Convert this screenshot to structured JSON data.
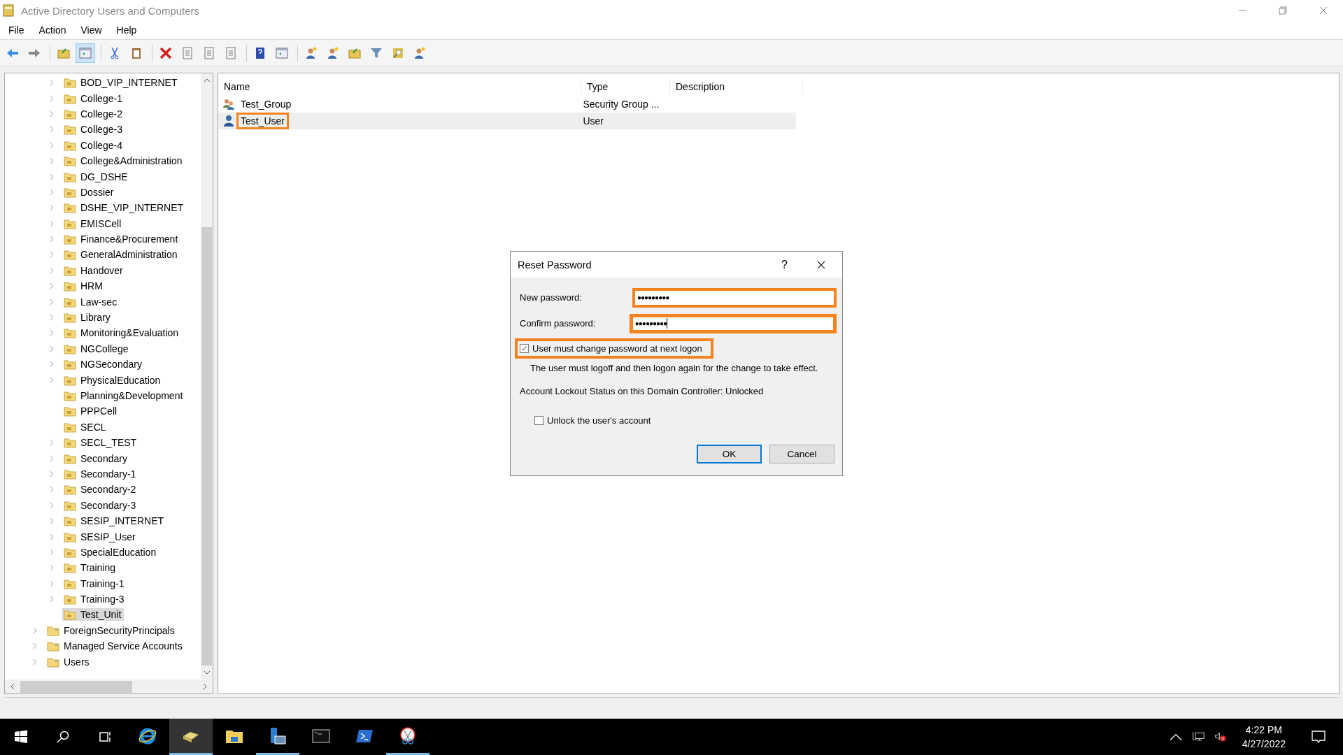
{
  "window": {
    "title": "Active Directory Users and Computers"
  },
  "menu": [
    "File",
    "Action",
    "View",
    "Help"
  ],
  "toolbar_buttons": [
    {
      "pressed": false
    },
    {
      "pressed": false
    },
    {
      "pressed": false
    },
    {
      "pressed": true
    },
    {
      "pressed": false
    },
    {
      "pressed": false
    },
    {
      "pressed": false
    },
    {
      "pressed": false
    },
    {
      "pressed": false
    },
    {
      "pressed": false
    },
    {
      "pressed": false
    },
    {
      "pressed": false
    },
    {
      "pressed": false
    },
    {
      "pressed": false
    },
    {
      "pressed": false
    },
    {
      "pressed": false
    },
    {
      "pressed": false
    },
    {
      "pressed": false
    }
  ],
  "tree": [
    {
      "children": [
        {
          "label": "BOD_VIP_INTERNET",
          "kind": "ou",
          "expandable": true,
          "selected": false
        },
        {
          "label": "College-1",
          "kind": "ou",
          "expandable": true,
          "selected": false
        },
        {
          "label": "College-2",
          "kind": "ou",
          "expandable": true,
          "selected": false
        },
        {
          "label": "College-3",
          "kind": "ou",
          "expandable": true,
          "selected": false
        },
        {
          "label": "College-4",
          "kind": "ou",
          "expandable": true,
          "selected": false
        },
        {
          "label": "College&Administration",
          "kind": "ou",
          "expandable": true,
          "selected": false
        },
        {
          "label": "DG_DSHE",
          "kind": "ou",
          "expandable": true,
          "selected": false
        },
        {
          "label": "Dossier",
          "kind": "ou",
          "expandable": true,
          "selected": false
        },
        {
          "label": "DSHE_VIP_INTERNET",
          "kind": "ou",
          "expandable": true,
          "selected": false
        },
        {
          "label": "EMISCell",
          "kind": "ou",
          "expandable": true,
          "selected": false
        },
        {
          "label": "Finance&Procurement",
          "kind": "ou",
          "expandable": true,
          "selected": false
        },
        {
          "label": "GeneralAdministration",
          "kind": "ou",
          "expandable": true,
          "selected": false
        },
        {
          "label": "Handover",
          "kind": "ou",
          "expandable": true,
          "selected": false
        },
        {
          "label": "HRM",
          "kind": "ou",
          "expandable": true,
          "selected": false
        },
        {
          "label": "Law-sec",
          "kind": "ou",
          "expandable": true,
          "selected": false
        },
        {
          "label": "Library",
          "kind": "ou",
          "expandable": true,
          "selected": false
        },
        {
          "label": "Monitoring&Evaluation",
          "kind": "ou",
          "expandable": true,
          "selected": false
        },
        {
          "label": "NGCollege",
          "kind": "ou",
          "expandable": true,
          "selected": false
        },
        {
          "label": "NGSecondary",
          "kind": "ou",
          "expandable": true,
          "selected": false
        },
        {
          "label": "PhysicalEducation",
          "kind": "ou",
          "expandable": true,
          "selected": false
        },
        {
          "label": "Planning&Development",
          "kind": "ou",
          "expandable": false,
          "selected": false
        },
        {
          "label": "PPPCell",
          "kind": "ou",
          "expandable": false,
          "selected": false
        },
        {
          "label": "SECL",
          "kind": "ou",
          "expandable": false,
          "selected": false
        },
        {
          "label": "SECL_TEST",
          "kind": "ou",
          "expandable": true,
          "selected": false
        },
        {
          "label": "Secondary",
          "kind": "ou",
          "expandable": true,
          "selected": false
        },
        {
          "label": "Secondary-1",
          "kind": "ou",
          "expandable": true,
          "selected": false
        },
        {
          "label": "Secondary-2",
          "kind": "ou",
          "expandable": true,
          "selected": false
        },
        {
          "label": "Secondary-3",
          "kind": "ou",
          "expandable": true,
          "selected": false
        },
        {
          "label": "SESIP_INTERNET",
          "kind": "ou",
          "expandable": true,
          "selected": false
        },
        {
          "label": "SESIP_User",
          "kind": "ou",
          "expandable": true,
          "selected": false
        },
        {
          "label": "SpecialEducation",
          "kind": "ou",
          "expandable": true,
          "selected": false
        },
        {
          "label": "Training",
          "kind": "ou",
          "expandable": true,
          "selected": false
        },
        {
          "label": "Training-1",
          "kind": "ou",
          "expandable": true,
          "selected": false
        },
        {
          "label": "Training-3",
          "kind": "ou",
          "expandable": true,
          "selected": false
        },
        {
          "label": "Test_Unit",
          "kind": "ou",
          "expandable": false,
          "selected": true
        }
      ]
    },
    {
      "label": "ForeignSecurityPrincipals",
      "kind": "container",
      "expandable": true,
      "selected": false
    },
    {
      "label": "Managed Service Accounts",
      "kind": "container",
      "expandable": true,
      "selected": false
    },
    {
      "label": "Users",
      "kind": "container",
      "expandable": true,
      "selected": false
    }
  ],
  "table": {
    "columns": [
      "Name",
      "Type",
      "Description"
    ],
    "rows": [
      {
        "kind": "group",
        "name": "Test_Group",
        "type": "Security Group ...",
        "selected": false,
        "highlighted": false
      },
      {
        "kind": "user",
        "name": "Test_User",
        "type": "User",
        "selected": true,
        "highlighted": true
      }
    ]
  },
  "dialog": {
    "title": "Reset Password",
    "help": "?",
    "fields": [
      {
        "label": "New password:",
        "value": "●●●●●●●●●",
        "highlighted": true,
        "focused": false
      },
      {
        "label": "Confirm password:",
        "value": "●●●●●●●●●",
        "highlighted": true,
        "focused": true
      }
    ],
    "must_change": {
      "label": "User must change password at next logon",
      "checked": true,
      "highlighted": true
    },
    "note": "The user must logoff and then logon again for the change to take effect.",
    "lockout_status": "Account Lockout Status on this Domain Controller: Unlocked",
    "unlock": {
      "label": "Unlock the user's account",
      "checked": false
    },
    "buttons": [
      {
        "label": "OK",
        "default": true
      },
      {
        "label": "Cancel",
        "default": false
      }
    ]
  },
  "taskbar": {
    "apps": [
      {
        "active": false,
        "running": false
      },
      {
        "active": true,
        "running": true
      },
      {
        "active": false,
        "running": false
      },
      {
        "active": false,
        "running": true
      },
      {
        "active": false,
        "running": false
      },
      {
        "active": false,
        "running": false
      },
      {
        "active": false,
        "running": true
      }
    ],
    "time": "4:22 PM",
    "date": "4/27/2022"
  }
}
